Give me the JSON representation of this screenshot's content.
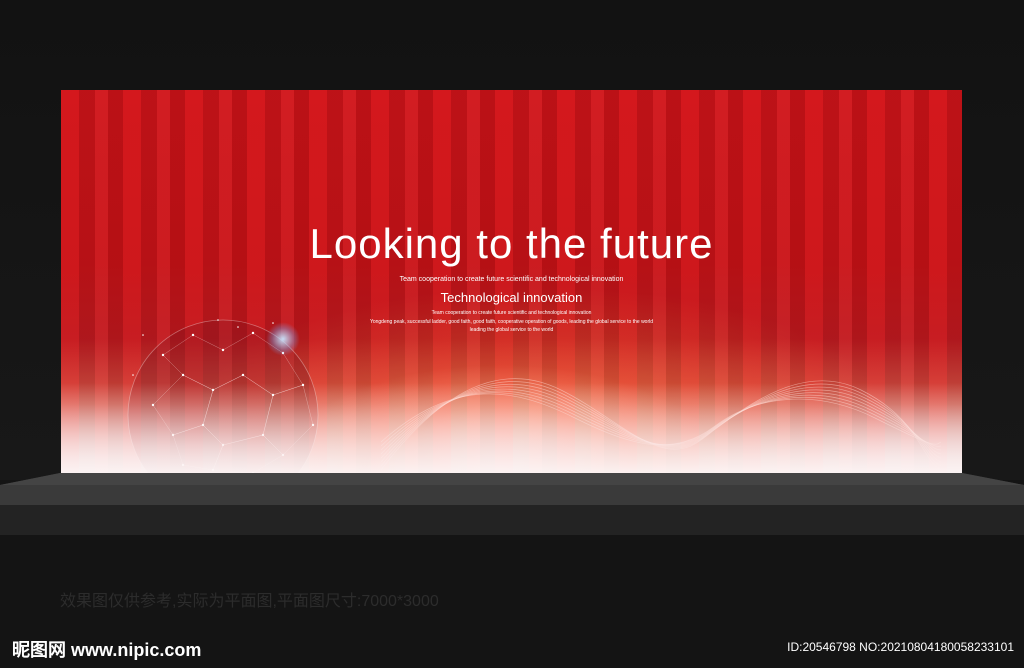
{
  "backdrop": {
    "headline": "Looking to the future",
    "subline": "Team cooperation to create future scientific and technological innovation",
    "tech_title": "Technological innovation",
    "small_lines": [
      "Team cooperation to create future scientific and technological innovation",
      "Yongdeng peak, successful ladder, good faith, good faith, cooperative operation of goods, leading the global service to the world",
      "leading the global service to the world"
    ]
  },
  "caption": "效果图仅供参考,实际为平面图,平面图尺寸:7000*3000",
  "footer": {
    "logo_text": "昵图网 www.nipic.com",
    "id_text": "ID:20546798 NO:20210804180058233101"
  },
  "colors": {
    "backdrop_red": "#c8141a",
    "stage_dark": "#141414"
  }
}
